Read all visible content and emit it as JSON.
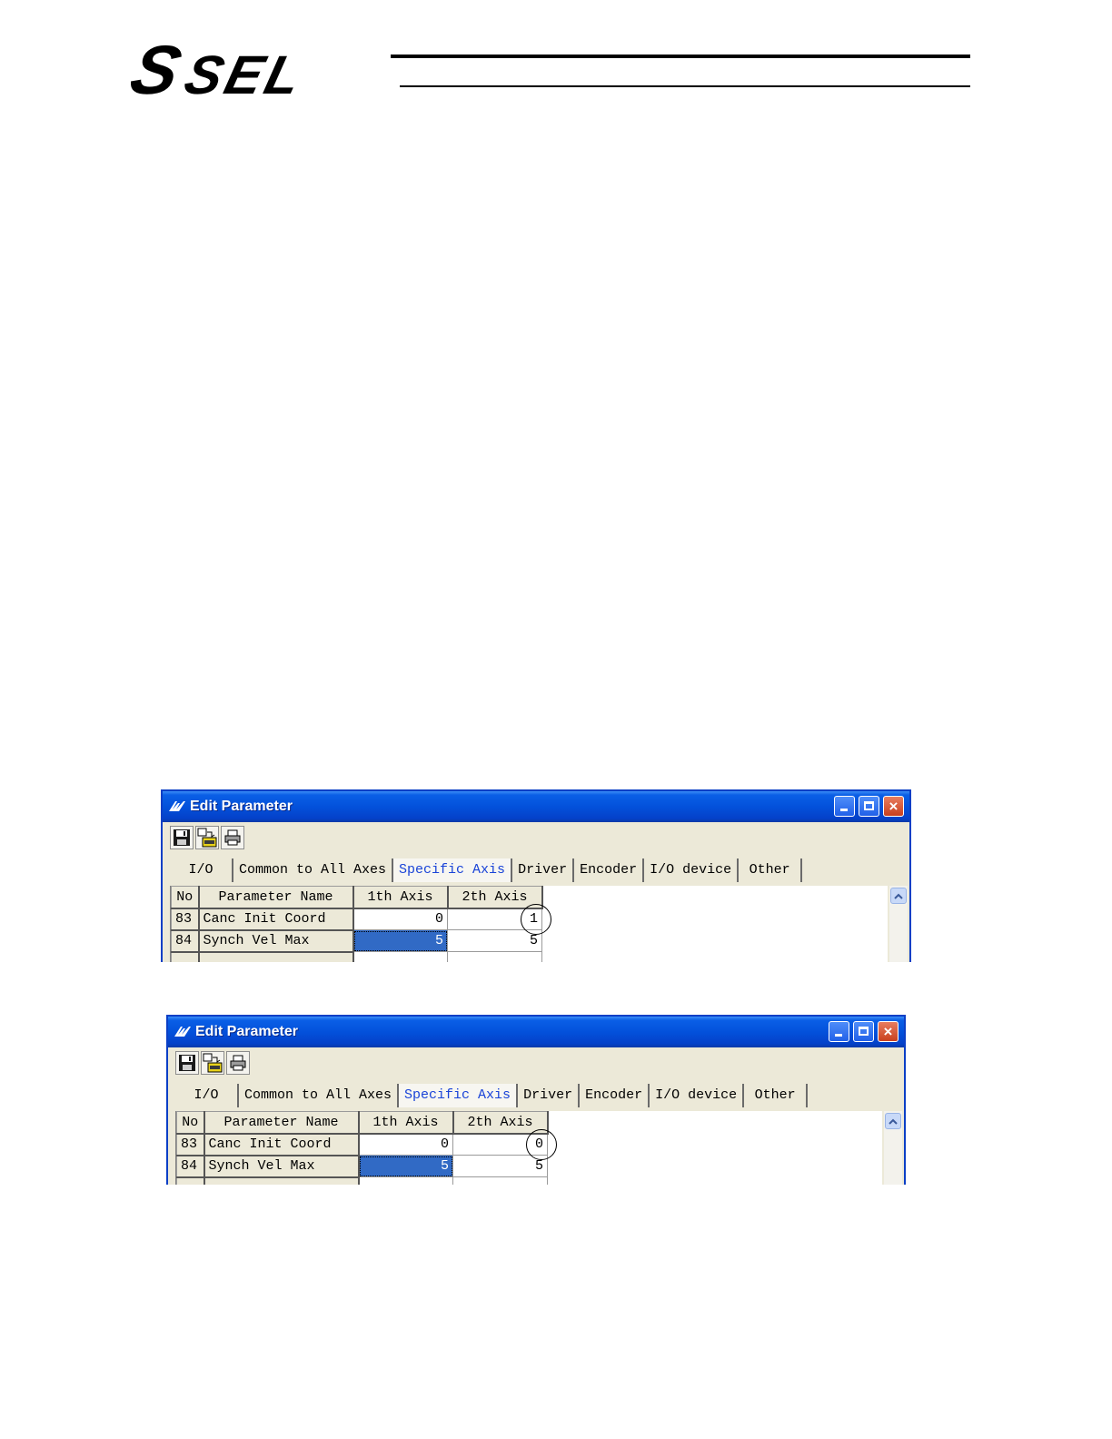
{
  "header": {
    "logo_s": "S",
    "logo_sel": "SEL"
  },
  "windows": [
    {
      "title": "Edit Parameter",
      "tabs": [
        "I/O",
        "Common to All Axes",
        "Specific Axis",
        "Driver",
        "Encoder",
        "I/O device",
        "Other"
      ],
      "active_tab": "Specific Axis",
      "columns": [
        "No",
        "Parameter Name",
        "1th Axis",
        "2th Axis"
      ],
      "rows": [
        {
          "no": "83",
          "name": "Canc Init Coord",
          "axis1": "0",
          "axis2": "1"
        },
        {
          "no": "84",
          "name": "Synch Vel Max",
          "axis1": "5",
          "axis2": "5"
        }
      ]
    },
    {
      "title": "Edit Parameter",
      "tabs": [
        "I/O",
        "Common to All Axes",
        "Specific Axis",
        "Driver",
        "Encoder",
        "I/O device",
        "Other"
      ],
      "active_tab": "Specific Axis",
      "columns": [
        "No",
        "Parameter Name",
        "1th Axis",
        "2th Axis"
      ],
      "rows": [
        {
          "no": "83",
          "name": "Canc Init Coord",
          "axis1": "0",
          "axis2": "0"
        },
        {
          "no": "84",
          "name": "Synch Vel Max",
          "axis1": "5",
          "axis2": "5"
        }
      ]
    }
  ],
  "colors": {
    "titlebar": "#0351db",
    "active_tab_text": "#1a44d8",
    "selected_cell": "#316ac5"
  },
  "icons": [
    "save-icon",
    "sel-transfer-icon",
    "print-icon",
    "minimize-icon",
    "maximize-icon",
    "close-icon",
    "scroll-up-icon"
  ]
}
